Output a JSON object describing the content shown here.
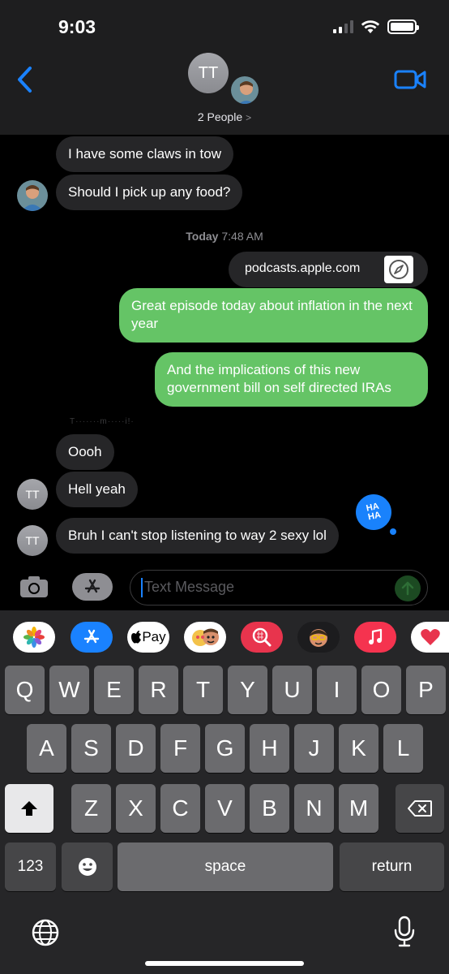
{
  "status": {
    "time": "9:03"
  },
  "header": {
    "avatar_initials": "TT",
    "group_name": "2 People",
    "chevron": ">"
  },
  "messages": {
    "incoming_1": "I have some claws in tow",
    "incoming_2": "Should I pick up any food?",
    "timestamp_day": "Today",
    "timestamp_time": "7:48 AM",
    "link_domain": "podcasts.apple.com",
    "outgoing_1": "Great episode today about inflation in the next year",
    "outgoing_2": "And the implications of this new government bill on self directed IRAs",
    "faded_text": "T·······m·····i!·",
    "incoming_3": "Oooh",
    "incoming_4": "Hell yeah",
    "incoming_5": "Bruh I can't stop listening to way 2 sexy lol",
    "sender_initials": "TT",
    "tapback_line1": "HA",
    "tapback_line2": "HA"
  },
  "composer": {
    "placeholder": "Text Message"
  },
  "app_strip": {
    "apple_pay_label": "Pay"
  },
  "keyboard": {
    "row1": [
      "Q",
      "W",
      "E",
      "R",
      "T",
      "Y",
      "U",
      "I",
      "O",
      "P"
    ],
    "row2": [
      "A",
      "S",
      "D",
      "F",
      "G",
      "H",
      "J",
      "K",
      "L"
    ],
    "row3": [
      "Z",
      "X",
      "C",
      "V",
      "B",
      "N",
      "M"
    ],
    "numbers_label": "123",
    "space_label": "space",
    "return_label": "return"
  },
  "colors": {
    "incoming_bubble": "#262628",
    "outgoing_bubble": "#65c466",
    "accent_blue": "#1982fc"
  }
}
